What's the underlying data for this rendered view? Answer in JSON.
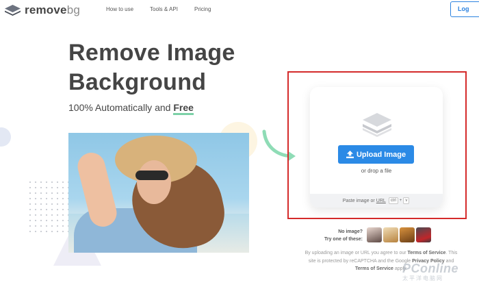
{
  "header": {
    "logo": {
      "brand": "remove",
      "brand_suffix": "bg"
    },
    "nav": [
      {
        "label": "How to use"
      },
      {
        "label": "Tools & API"
      },
      {
        "label": "Pricing"
      }
    ],
    "login_label": "Log"
  },
  "hero": {
    "title_line1": "Remove Image",
    "title_line2": "Background",
    "subtitle_prefix": "100% Automatically and",
    "subtitle_highlight": "Free"
  },
  "upload": {
    "button_label": "Upload Image",
    "drop_text": "or drop a file",
    "paste_prefix": "Paste image or",
    "paste_url": "URL",
    "keys": [
      "ctrl",
      "v"
    ],
    "key_joiner": "+"
  },
  "samples": {
    "label_line1": "No image?",
    "label_line2": "Try one of these:",
    "items": [
      {
        "icon": "sample-woman-icon",
        "color": "#6b5a52"
      },
      {
        "icon": "sample-dog-icon",
        "color": "#c79a5a"
      },
      {
        "icon": "sample-book-icon",
        "color": "#a1682c"
      },
      {
        "icon": "sample-car-icon",
        "color": "#b0292b"
      }
    ]
  },
  "legal": {
    "part1": "By uploading an image or URL you agree to our",
    "terms_link": "Terms of Service",
    "part2": ". This site is protected by reCAPTCHA and the Google",
    "privacy_link": "Privacy Policy",
    "part3": "and",
    "terms_link2": "Terms of Service",
    "part4": "apply."
  },
  "watermark": {
    "main": "PConline",
    "sub": "太平洋电脑网"
  },
  "colors": {
    "accent": "#2b8ae6",
    "highlight_frame": "#d42a2a",
    "free_underline": "#7cd1a7",
    "text_dark": "#454545"
  }
}
